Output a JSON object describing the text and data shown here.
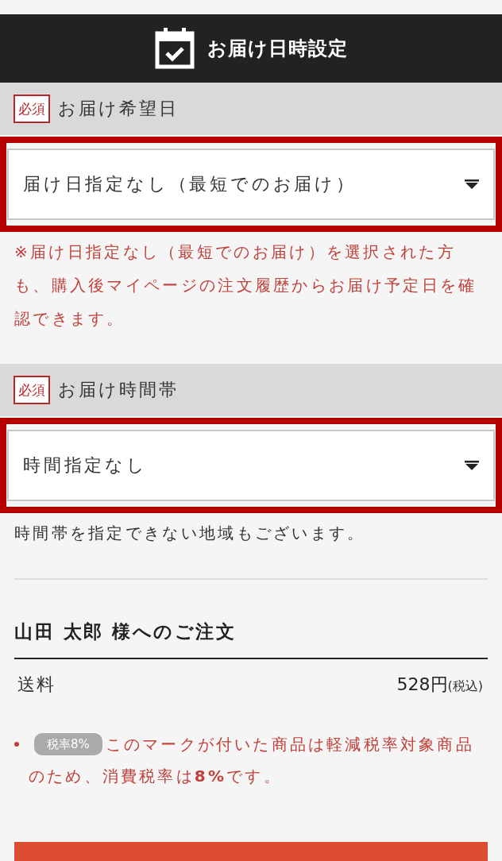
{
  "header": {
    "title": "お届け日時設定"
  },
  "fields": [
    {
      "required_badge": "必須",
      "label": "お届け希望日",
      "highlighted": true,
      "select": {
        "value": "届け日指定なし（最短でのお届け）"
      },
      "note": {
        "kind": "warning",
        "text": "※届け日指定なし（最短でのお届け）を選択された方も、購入後マイページの注文履歴からお届け予定日を確認できます。"
      }
    },
    {
      "required_badge": "必須",
      "label": "お届け時間帯",
      "highlighted": true,
      "select": {
        "value": "時間指定なし"
      },
      "note": {
        "kind": "info",
        "text": "時間帯を指定できない地域もございます。"
      }
    }
  ],
  "order": {
    "title": "山田 太郎 様へのご注文",
    "rows": [
      {
        "label": "送料",
        "value": "528円",
        "suffix": "(税込)"
      }
    ],
    "notes": [
      {
        "badge": "税率8%",
        "text": "このマークが付いた商品は軽減税率対象商品のため、消費税率は**8%**です。"
      }
    ]
  }
}
